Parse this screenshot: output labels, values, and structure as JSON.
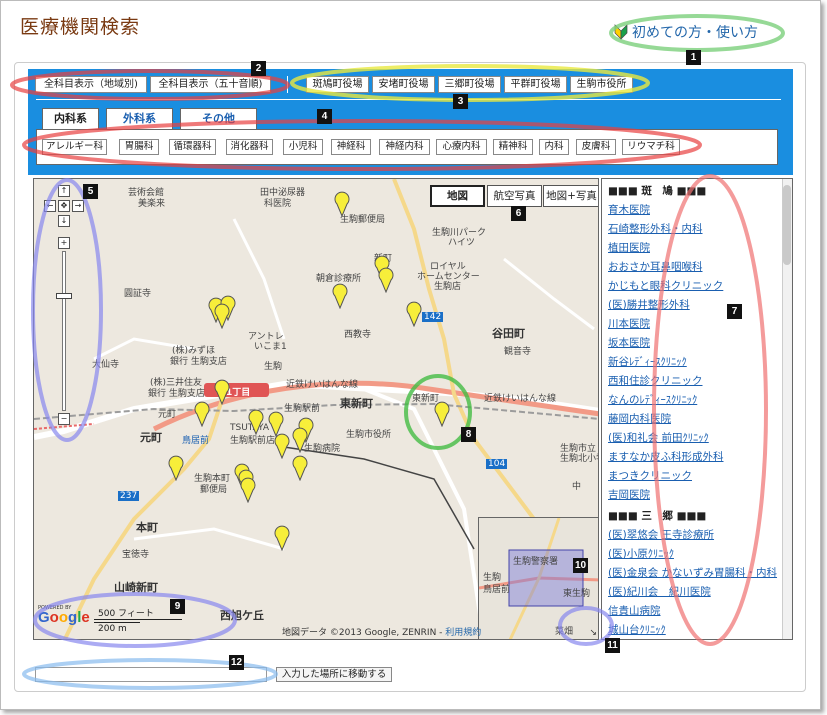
{
  "title": "医療機関検索",
  "help_link": "初めての方・使い方",
  "badges": [
    "1",
    "2",
    "3",
    "4",
    "5",
    "6",
    "7",
    "8",
    "9",
    "10",
    "11",
    "12"
  ],
  "area_buttons": [
    {
      "label": "全科目表示（地域別)"
    },
    {
      "label": "全科目表示（五十音順)"
    }
  ],
  "office_buttons": [
    {
      "label": "斑鳩町役場"
    },
    {
      "label": "安堵町役場"
    },
    {
      "label": "三郷町役場"
    },
    {
      "label": "平群町役場"
    },
    {
      "label": "生駒市役所"
    }
  ],
  "tabs": [
    {
      "label": "内科系",
      "active": true
    },
    {
      "label": "外科系",
      "active": false
    },
    {
      "label": "その他",
      "active": false
    }
  ],
  "subjects": [
    "アレルギー科",
    "胃腸科",
    "循環器科",
    "消化器科",
    "小児科",
    "神経科",
    "神経内科",
    "心療内科",
    "精神科",
    "内科",
    "皮膚科",
    "リウマチ科"
  ],
  "map_types": [
    {
      "label": "地図",
      "selected": true
    },
    {
      "label": "航空写真",
      "selected": false
    },
    {
      "label": "地図+写真",
      "selected": false
    }
  ],
  "map_labels": {
    "tamon_sakura": "芸術会館",
    "bijutsu": "美楽来",
    "tanaka": "田中泌尿器",
    "tanaka2": "科医院",
    "ikoma_post": "生駒郵便局",
    "ikoma_park": "生駒川パーク",
    "heights": "ハイツ",
    "tanimachi": "谷田町",
    "royal": "ロイヤル",
    "homecenter": "ホームセンター",
    "homecenter2": "生駒店",
    "asagiri": "朝倉診療所",
    "enshoji": "圓証寺",
    "saikyoji": "西教寺",
    "antre": "アントレ",
    "antre2": "いこま1",
    "mizuho": "(株)みずほ",
    "mizuho2": "銀行 生駒支店",
    "sumitomo": "(株)三井住友",
    "sumitomo2": "銀行 生駒支店",
    "daisenji": "大仙寺",
    "kannonji": "観音寺",
    "ikoma": "生駒",
    "higashishinmachi": "東新町",
    "kintetsu1": "近鉄けいはんな線",
    "kintetsu2": "近鉄けいはんな線",
    "ikoma_eki": "生駒駅前",
    "higashi_shinmachi_st": "東新町",
    "motomachi": "元町",
    "motomachi2": "元町",
    "toriimae": "鳥居前",
    "tsutaya": "TSUTAYA",
    "tsutaya2": "生駒駅前店",
    "ikoma_city": "生駒市役所",
    "ikoma_hospital": "生駒市立",
    "ikoma_hospital2": "生駒北小学校",
    "ikomahonmachi": "生駒本町",
    "ikomahonmachi2": "郵便局",
    "honmachi": "本町",
    "hojuji": "宝徳寺",
    "yamazakishinmachi": "山崎新町",
    "nishiasahigaoka": "西旭ケ丘",
    "kakibyoin": "生駒病院",
    "ichome": "1丁目",
    "naka": "中",
    "r142": "142",
    "r104": "104",
    "r237": "237",
    "shinmachi": "新町"
  },
  "scale": {
    "feet": "500 フィート",
    "meters": "200 m"
  },
  "copyright": "地図データ ©2013 Google, ZENRIN -",
  "terms": "利用規約",
  "powered_by": "POWERED BY",
  "google": "Google",
  "overview_labels": {
    "a": "生駒警察署",
    "b": "生駒",
    "c": "鳥居前",
    "d": "東生駒",
    "e": "菜畑"
  },
  "list": {
    "groups": [
      {
        "title": "■■■ 斑　鳩 ■■■",
        "items": [
          "育木医院",
          "石崎整形外科・内科",
          "植田医院",
          "おおさか耳鼻咽喉科",
          "かじもと眼科クリニック",
          "(医)勝井整形外科",
          "川本医院",
          "坂本医院",
          "新谷ﾚﾃﾞｨｰｽｸﾘﾆｯｸ",
          "西和住診クリニック",
          "なんのﾚﾃﾞｨｰｽｸﾘﾆｯｸ",
          "藤岡内科医院",
          "(医)和礼会 前田ｸﾘﾆｯｸ",
          "ますなか皮ふ科形成外科",
          "まつきクリニック",
          "吉岡医院"
        ]
      },
      {
        "title": "■■■ 三　郷 ■■■",
        "items": [
          "(医)翠悠会 王寺診療所",
          "(医)小原ｸﾘﾆｯｸ",
          "(医)金泉会 かないずみ胃腸科・内科",
          "(医)紀川会　紀川医院",
          "信貴山病院",
          "城山台ｸﾘﾆｯｸ"
        ]
      }
    ]
  },
  "search": {
    "button": "入力した場所に移動する",
    "placeholder": ""
  }
}
